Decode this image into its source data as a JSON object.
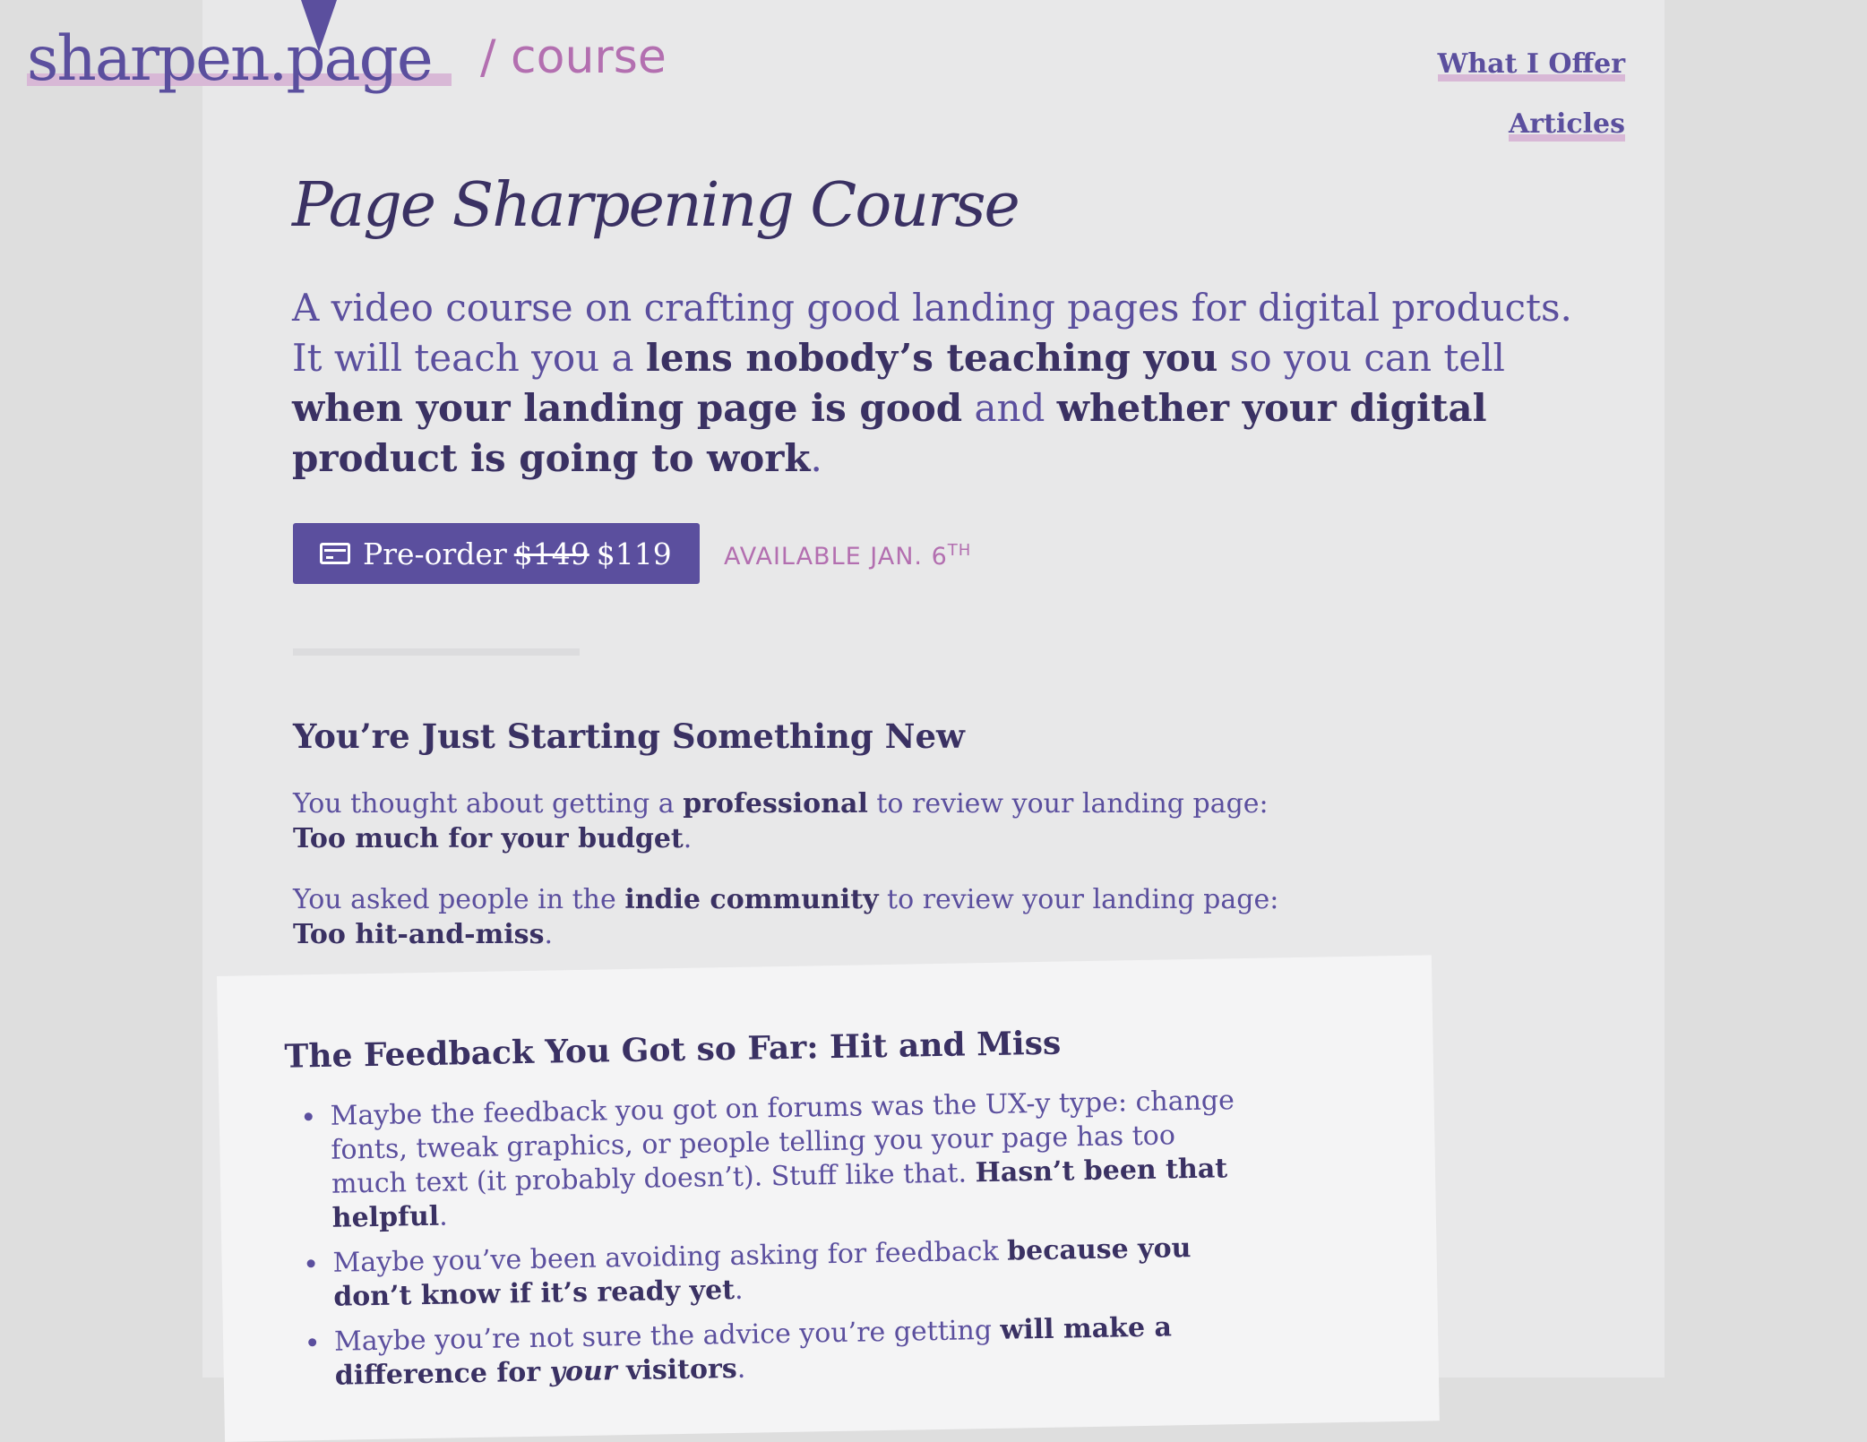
{
  "header": {
    "logo_text": "sharpen.page",
    "logo_suffix": "/ course",
    "nav": [
      {
        "label": "What I Offer"
      },
      {
        "label": "Articles"
      }
    ]
  },
  "hero": {
    "title": "Page Sharpening Course",
    "lede": {
      "t1": "A video course on crafting good landing pages for digital products. It will teach you a ",
      "b1": "lens nobody’s teaching you",
      "t2": " so you can tell ",
      "b2": "when your landing page is good",
      "t3": " and ",
      "b3": "whether your digital product is going to work",
      "t4": "."
    },
    "cta": {
      "label": "Pre-order",
      "old_price": "$149",
      "price": "$119",
      "icon": "credit-card-icon"
    },
    "availability": {
      "text": "AVAILABLE JAN. 6",
      "suffix": "TH"
    }
  },
  "section": {
    "heading": "You’re Just Starting Something New",
    "p1": {
      "t1": "You thought about getting a ",
      "b1": "professional",
      "t2": " to review your landing page:",
      "b2": "Too much for your budget",
      "t3": "."
    },
    "p2": {
      "t1": "You asked people in the ",
      "b1": "indie community",
      "t2": " to review your landing page:",
      "b2": "Too hit-and-miss",
      "t3": "."
    }
  },
  "card": {
    "heading": "The Feedback You Got so Far: Hit and Miss",
    "items": [
      {
        "t1": "Maybe the feedback you got on forums was the UX-y type: change fonts, tweak graphics, or people telling you your page has too much text (it probably doesn’t). Stuff like that. ",
        "b1": "Hasn’t been that helpful",
        "t2": "."
      },
      {
        "t1": "Maybe you’ve been avoiding asking for feedback ",
        "b1": "because you don’t know if it’s ready yet",
        "t2": "."
      },
      {
        "t1": "Maybe you’re not sure the advice you’re getting ",
        "b1": "will make a difference for ",
        "i1": "your",
        "b2": " visitors",
        "t2": "."
      }
    ]
  },
  "colors": {
    "accent": "#5b4f9e",
    "dark": "#3a3163",
    "pink": "#b36fb0",
    "highlight": "#d8b8d6"
  }
}
